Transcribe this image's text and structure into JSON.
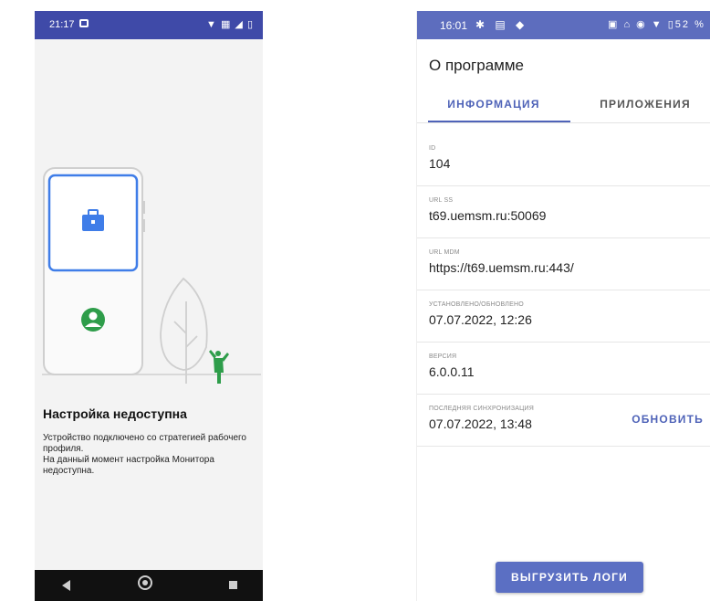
{
  "left_screen": {
    "status_bar": {
      "time": "21:17",
      "icons_right": "▼ ▦ ◢ ▯"
    },
    "illustration": {
      "icons": [
        "briefcase-icon",
        "person-icon",
        "tree-icon",
        "person-figure-icon"
      ],
      "colors": {
        "blue": "#3f7de8",
        "green": "#2e9d4a",
        "outline": "#c9c9c9"
      }
    },
    "title": "Настройка недоступна",
    "description": "Устройство подключено со стратегией рабочего профиля.\nНа данный момент настройка Монитора недоступна.",
    "nav_bar": {
      "icons": [
        "back-icon",
        "home-icon",
        "recents-icon"
      ]
    }
  },
  "right_screen": {
    "status_bar": {
      "time": "16:01",
      "icons_left": "✱ ▤ ◆",
      "icons_right": "▣ ⌂ ◉ ▼ ▯52 %"
    },
    "app_title": "О программе",
    "tabs": [
      {
        "label": "ИНФОРМАЦИЯ",
        "active": true
      },
      {
        "label": "ПРИЛОЖЕНИЯ",
        "active": false
      }
    ],
    "rows": [
      {
        "label": "ID",
        "value": "104"
      },
      {
        "label": "URL SS",
        "value": "t69.uemsm.ru:50069"
      },
      {
        "label": "URL MDM",
        "value": "https://t69.uemsm.ru:443/"
      },
      {
        "label": "УСТАНОВЛЕНО/ОБНОВЛЕНО",
        "value": "07.07.2022, 12:26"
      },
      {
        "label": "ВЕРСИЯ",
        "value": "6.0.0.11"
      },
      {
        "label": "ПОСЛЕДНЯЯ СИНХРОНИЗАЦИЯ",
        "value": "07.07.2022, 13:48"
      }
    ],
    "refresh_label": "ОБНОВИТЬ",
    "upload_logs_label": "ВЫГРУЗИТЬ ЛОГИ",
    "colors": {
      "accent": "#4f63b8",
      "status_bar": "#5d6dbe",
      "button": "#5b6fc3"
    }
  }
}
